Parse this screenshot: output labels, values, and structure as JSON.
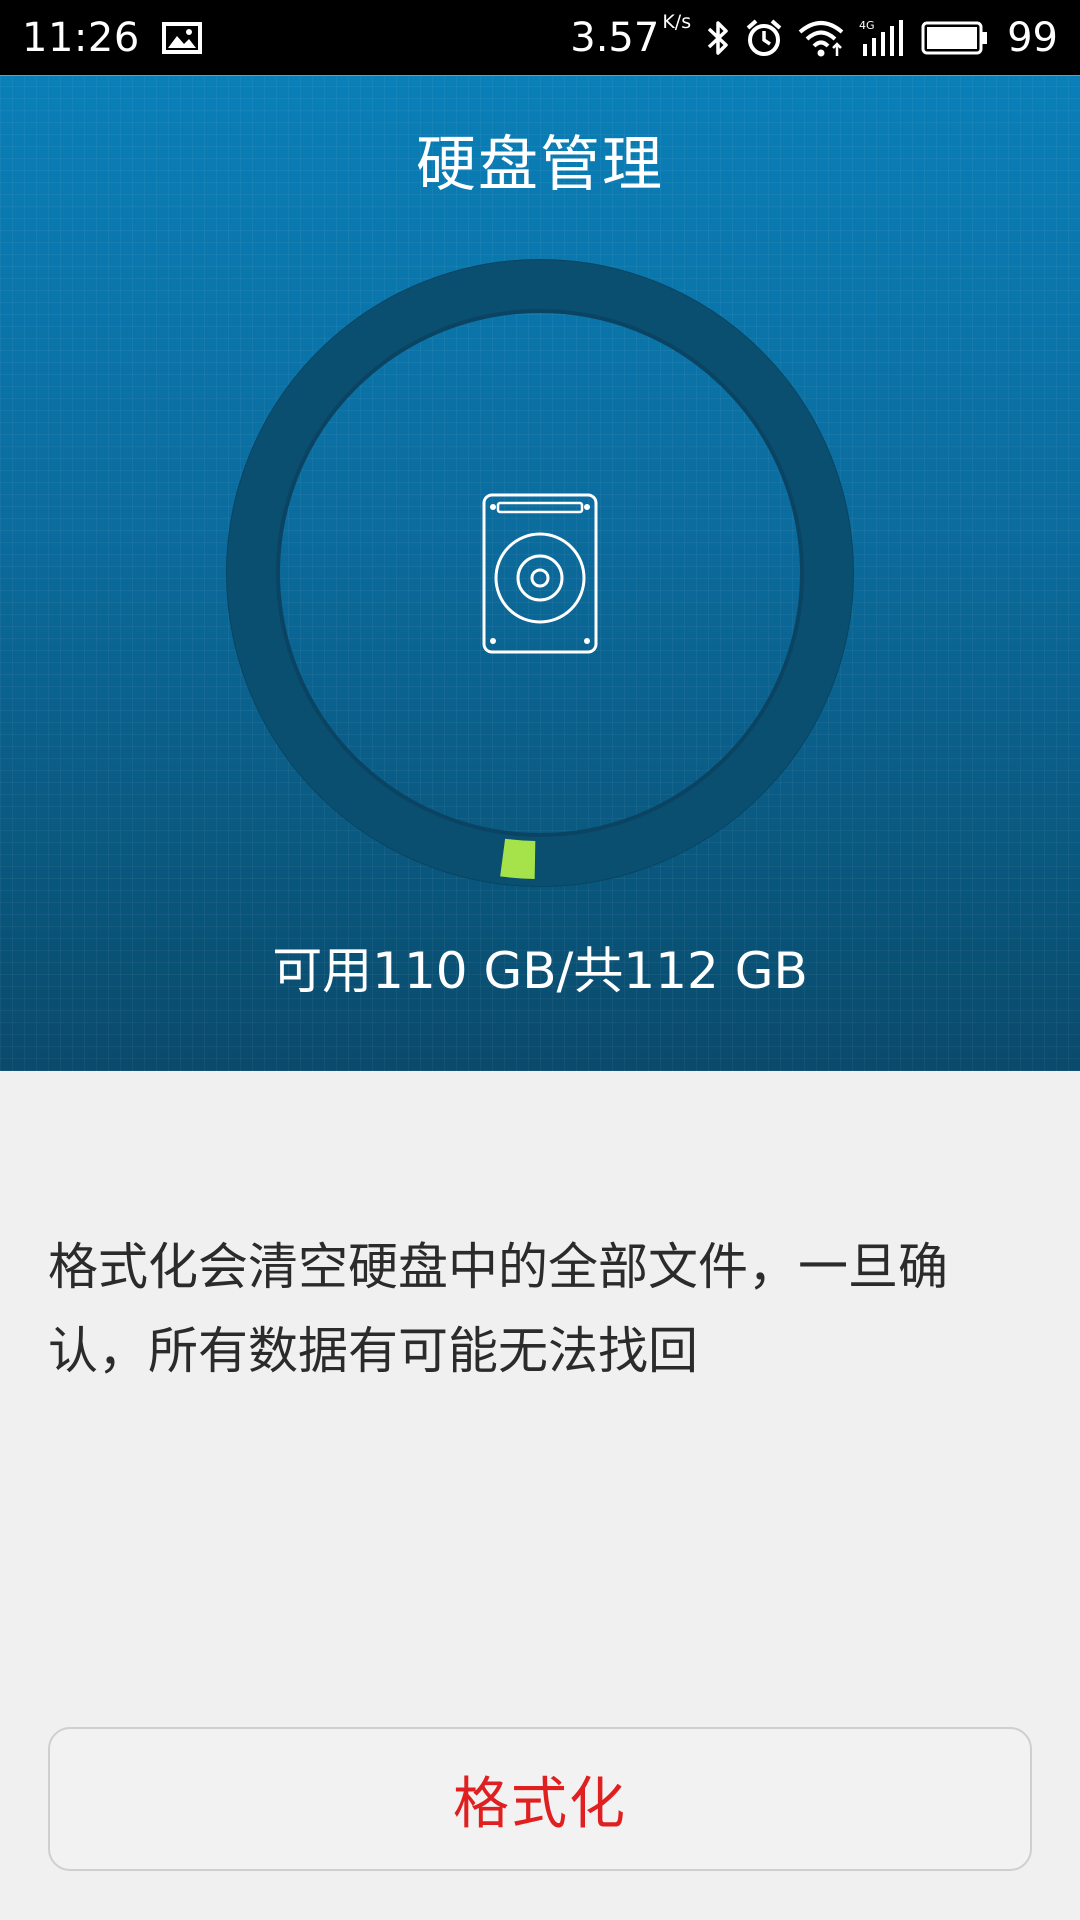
{
  "status_bar": {
    "time": "11:26",
    "network_speed": "3.57",
    "network_speed_unit": "K/s",
    "battery_level": "99",
    "icons": [
      "image-icon",
      "bluetooth-icon",
      "alarm-icon",
      "wifi-icon",
      "4g-signal-icon",
      "battery-icon"
    ]
  },
  "header": {
    "title": "硬盘管理"
  },
  "storage": {
    "summary": "可用110 GB/共112 GB",
    "used_fraction": 0.018,
    "ring_color": "#0b4a6a",
    "used_color": "#a6e34a"
  },
  "warning": {
    "text": "格式化会清空硬盘中的全部文件，一旦确认，所有数据有可能无法找回"
  },
  "actions": {
    "format_label": "格式化",
    "format_color": "#e02020"
  }
}
